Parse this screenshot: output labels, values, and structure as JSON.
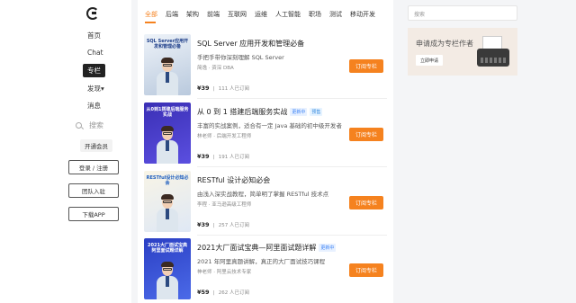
{
  "sidebar": {
    "nav": [
      "首页",
      "Chat",
      "专栏",
      "发现",
      "消息"
    ],
    "search": "搜索",
    "vip": "开通会员",
    "login": "登录 / 注册",
    "team": "团队入驻",
    "download": "下载APP"
  },
  "tabs": [
    "全部",
    "后端",
    "架构",
    "前端",
    "互联网",
    "运维",
    "人工智能",
    "职场",
    "测试",
    "移动开发"
  ],
  "items": [
    {
      "cover_text": "SQL Server应用开发和管理必备",
      "cover_colors": [
        "#eef3f9",
        "#b9c9dd"
      ],
      "title": "SQL Server 应用开发和管理必备",
      "badge": "",
      "desc": "手把手带你深刻理解 SQL Server",
      "author": "简逸 · 资深 DBA",
      "price": "¥39",
      "subs": "111 人已订阅",
      "button": "订阅专栏"
    },
    {
      "cover_text": "从0到1搭建后端服务实战",
      "cover_colors": [
        "#3a2fb5",
        "#5b4fe0"
      ],
      "title": "从 0 到 1 搭建后端服务实战",
      "badge": "更新中",
      "badge2": "预售",
      "desc": "丰富的实战案例，适合有一定 Java 基础的初中级开发者",
      "author": "林老师 · 后端开发工程师",
      "price": "¥39",
      "subs": "191 人已订阅",
      "button": "订阅专栏"
    },
    {
      "cover_text": "RESTful设计必知必会",
      "cover_colors": [
        "#f8f4e6",
        "#dfe8f5"
      ],
      "title": "RESTful 设计必知必会",
      "badge": "",
      "desc": "由浅入深实战教程，简单明了掌握 RESTful 技术点",
      "author": "李程 · 亚马逊高级工程师",
      "price": "¥39",
      "subs": "257 人已订阅",
      "button": "订阅专栏"
    },
    {
      "cover_text": "2021大厂面试宝典阿里面试题详解",
      "cover_colors": [
        "#2b3fc4",
        "#4b6ae8"
      ],
      "title": "2021大厂面试宝典—阿里面试题详解",
      "badge": "更新中",
      "desc": "2021 年阿里真题讲解，真正的大厂面试技巧课程",
      "author": "神老师 · 阿里云技术专家",
      "price": "¥59",
      "subs": "262 人已订阅",
      "button": "订阅专栏"
    }
  ],
  "right": {
    "search_placeholder": "搜索",
    "promo_title": "申请成为专栏作者",
    "promo_button": "立即申请"
  },
  "colors": {
    "accent": "#f5821f"
  }
}
